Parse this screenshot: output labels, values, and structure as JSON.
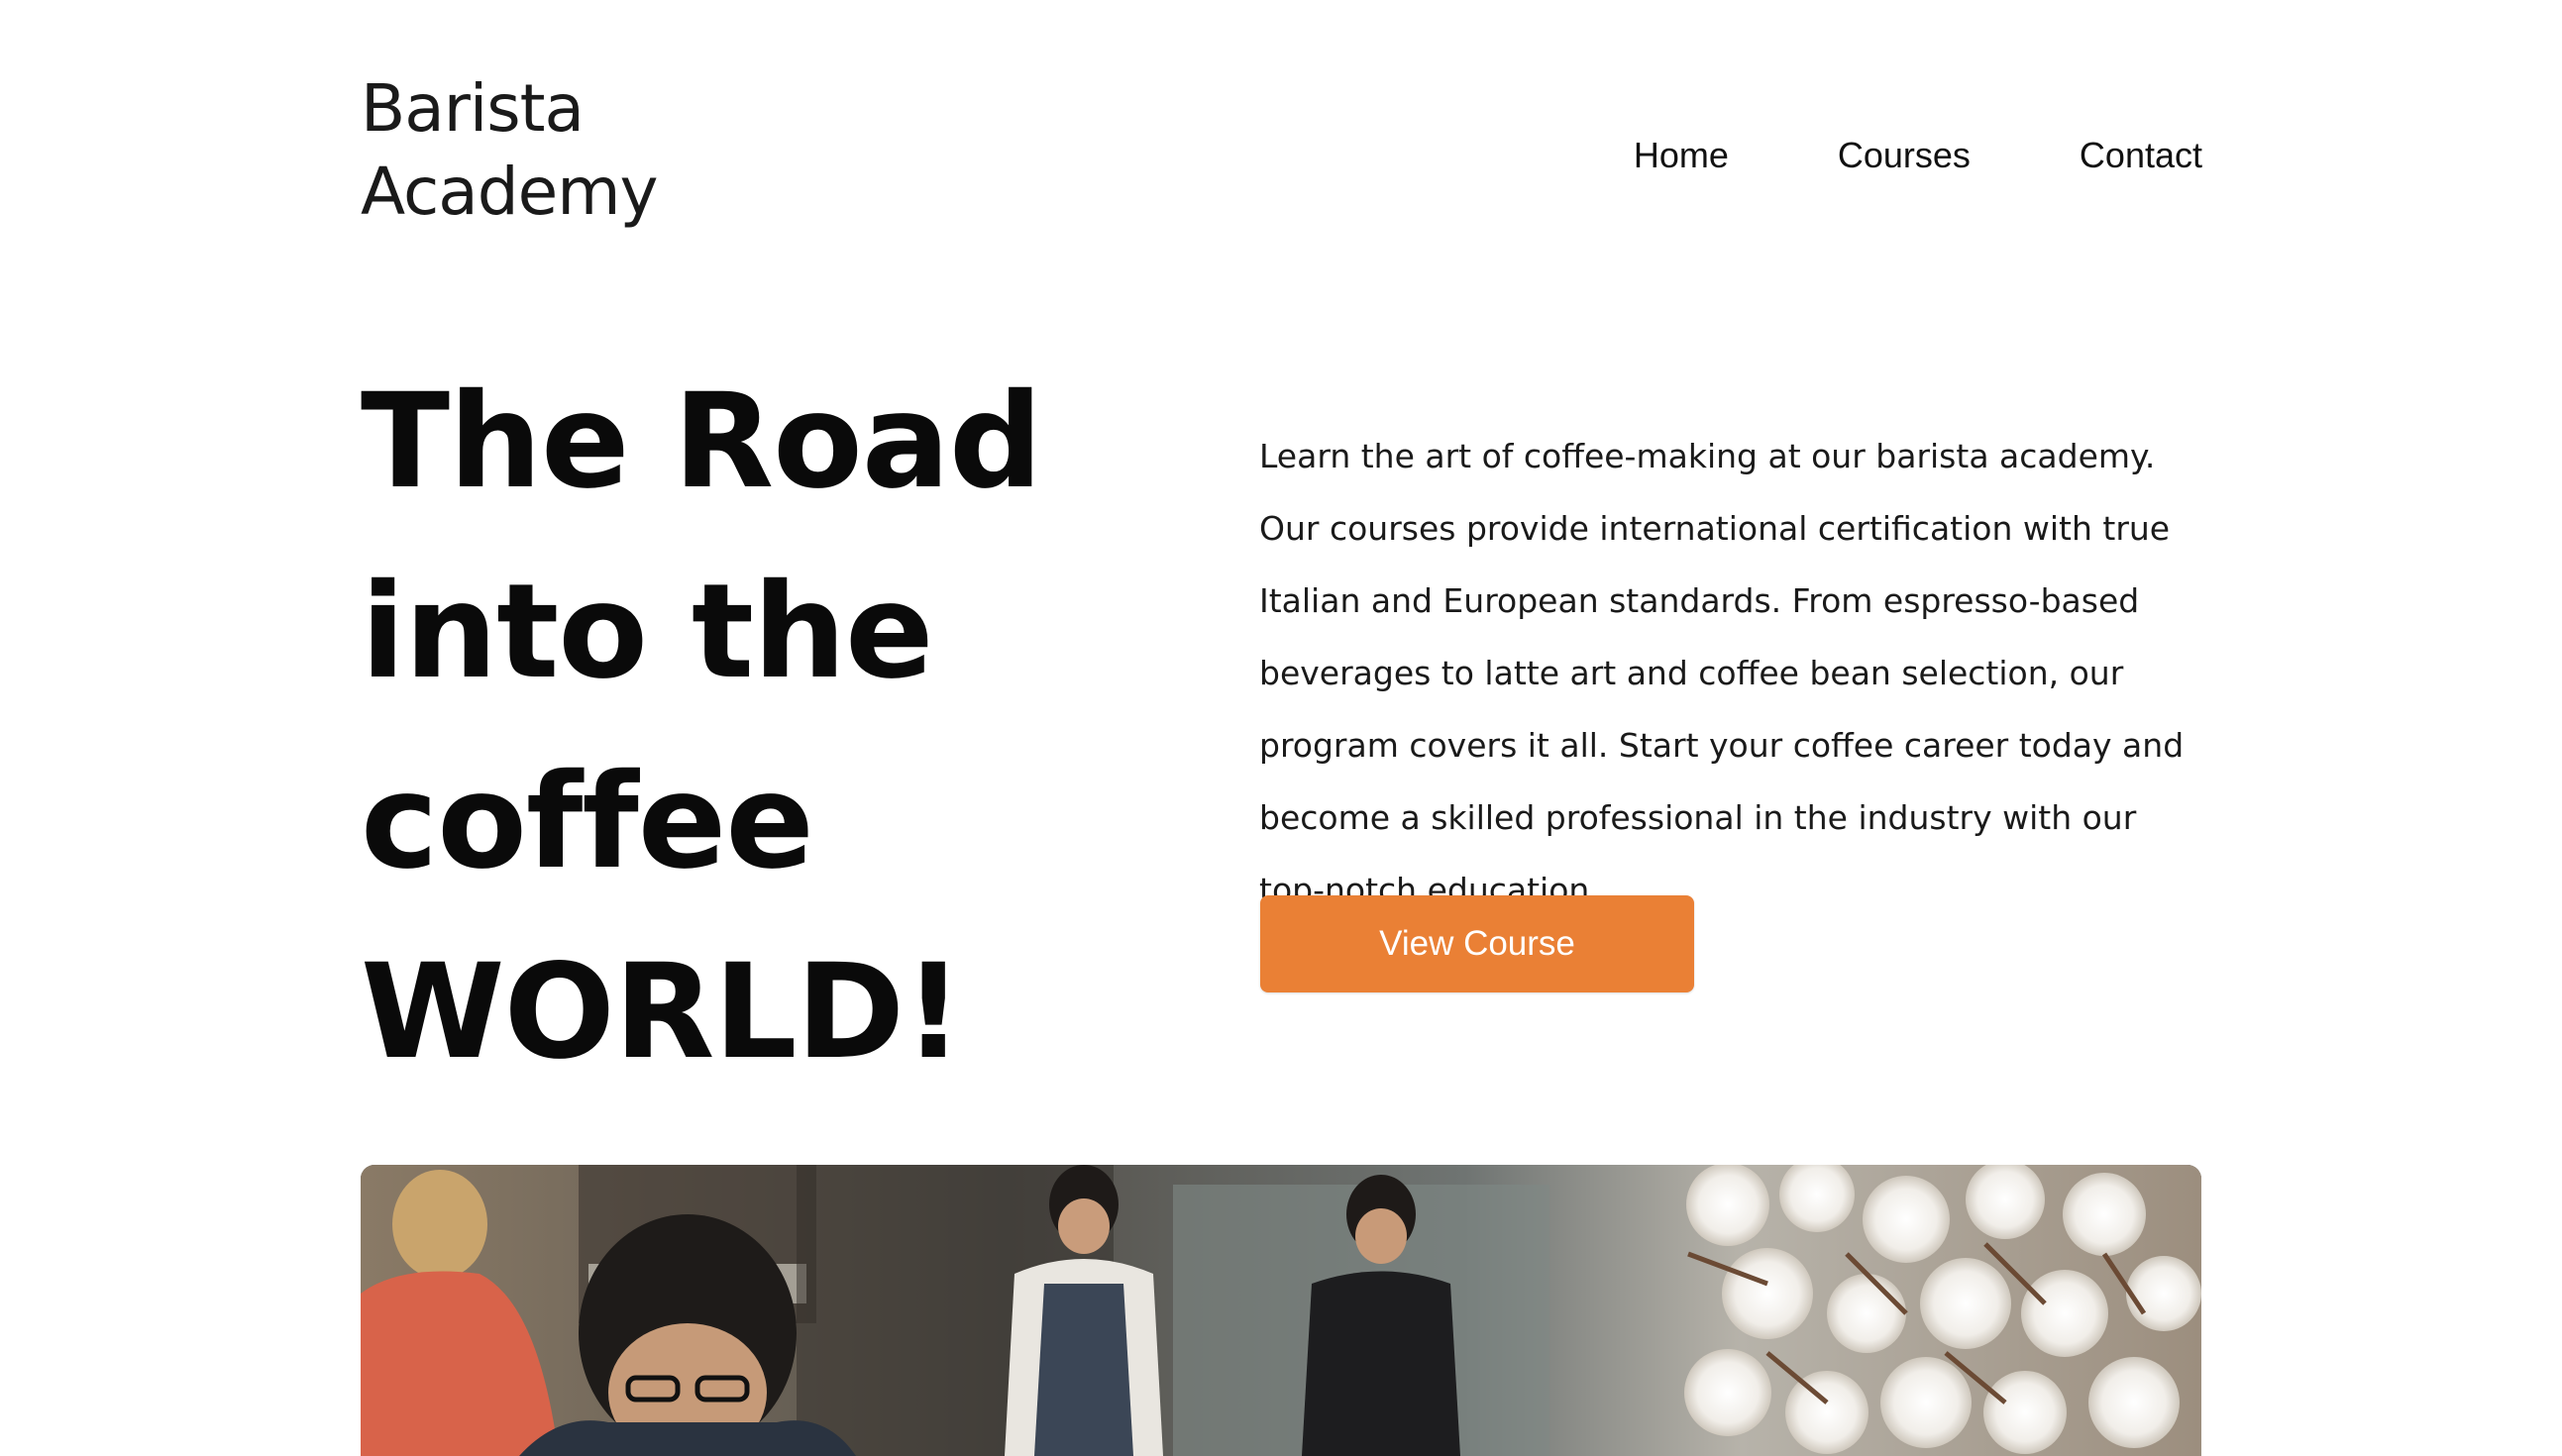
{
  "brand": {
    "line1": "Barista",
    "line2": "Academy"
  },
  "nav": {
    "items": [
      {
        "label": "Home"
      },
      {
        "label": "Courses"
      },
      {
        "label": "Contact"
      }
    ]
  },
  "hero": {
    "title_lines": [
      "The Road",
      "into the",
      "coffee",
      "WORLD!"
    ],
    "description": "Learn the art of coffee-making at our barista academy. Our courses provide international certification with true Italian and European standards. From espresso-based beverages to latte art and coffee bean selection, our program covers it all. Start your coffee career today and become a skilled professional in the industry with our top-notch education",
    "cta_label": "View Course"
  },
  "colors": {
    "accent": "#ea8035",
    "text": "#111111",
    "background": "#ffffff"
  }
}
